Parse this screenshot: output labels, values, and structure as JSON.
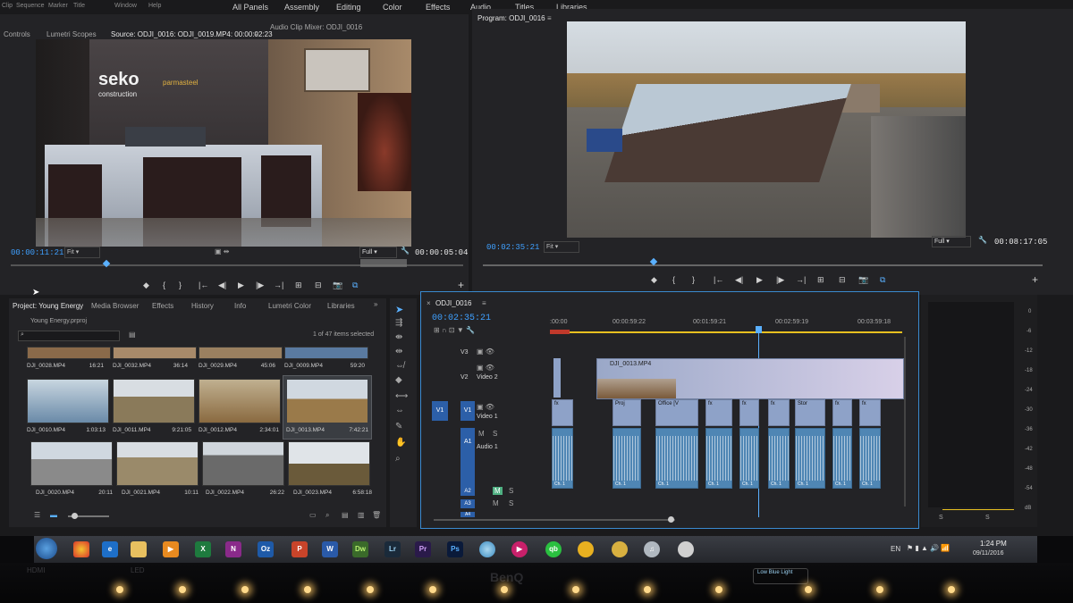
{
  "menu": {
    "items": [
      "Clip",
      "Sequence",
      "Marker",
      "Title",
      "Window",
      "Help"
    ]
  },
  "workspaces": [
    "All Panels",
    "Assembly",
    "Editing",
    "Color",
    "Effects",
    "Audio",
    "Titles",
    "Libraries"
  ],
  "source_panel": {
    "tabs": [
      "Controls",
      "Lumetri Scopes",
      "Source: ODJI_0016: ODJI_0019.MP4: 00:00:02:23",
      "Audio Clip Mixer: ODJI_0016"
    ],
    "menu_icon": "≡",
    "timecode_left": "00:00:11:21",
    "fit": "Fit",
    "zoom": "Full",
    "timecode_right": "00:00:05:04",
    "frame_logo_main": "seko",
    "frame_logo_sub": "construction",
    "frame_logo_partner": "parmasteel"
  },
  "program_panel": {
    "title": "Program: ODJI_0016",
    "menu_icon": "≡",
    "timecode_left": "00:02:35:21",
    "fit": "Fit",
    "zoom": "Full",
    "timecode_right": "00:08:17:05"
  },
  "transport_glyphs": [
    "◆",
    "{",
    "}",
    "|←",
    "◀|",
    "▶",
    "|▶",
    "→|",
    "⊞",
    "⊟",
    "📷",
    "⧉",
    "+"
  ],
  "project_panel": {
    "tabs": [
      "Project: Young Energy",
      "Media Browser",
      "Effects",
      "History",
      "Info",
      "Lumetri Color",
      "Libraries",
      "»"
    ],
    "project_file": "Young Energy.prproj",
    "items_selected": "1 of 47 items selected",
    "top_row": [
      {
        "name": "DJI_0028.MP4",
        "dur": "16:21"
      },
      {
        "name": "DJI_0032.MP4",
        "dur": "36:14"
      },
      {
        "name": "DJI_0029.MP4",
        "dur": "45:06"
      },
      {
        "name": "DJI_0009.MP4",
        "dur": "59:20"
      }
    ],
    "rows": [
      [
        {
          "name": "DJI_0010.MP4",
          "dur": "1:03:13"
        },
        {
          "name": "DJI_0011.MP4",
          "dur": "9:21:05"
        },
        {
          "name": "DJI_0012.MP4",
          "dur": "2:34:01"
        },
        {
          "name": "DJI_0013.MP4",
          "dur": "7:42:21"
        }
      ],
      [
        {
          "name": "DJI_0020.MP4",
          "dur": "20:11"
        },
        {
          "name": "DJI_0021.MP4",
          "dur": "10:11"
        },
        {
          "name": "DJI_0022.MP4",
          "dur": "26:22"
        },
        {
          "name": "DJI_0023.MP4",
          "dur": "6:58:18"
        }
      ]
    ]
  },
  "timeline": {
    "sequence_tab": "ODJI_0016",
    "close_glyph": "×",
    "menu_icon": "≡",
    "timecode": "00:02:35:21",
    "ruler": [
      ":00:00",
      "00:00:59:22",
      "00:01:59:21",
      "00:02:59:19",
      "00:03:59:18"
    ],
    "tracks_video": [
      {
        "id": "V3",
        "name": ""
      },
      {
        "id": "V2",
        "name": "Video 2"
      },
      {
        "id": "V1",
        "name": "Video 1",
        "src": "V1"
      }
    ],
    "tracks_audio": [
      {
        "id": "A1",
        "name": "Audio 1",
        "src": "A1"
      },
      {
        "id": "A2",
        "name": ""
      },
      {
        "id": "A3",
        "name": ""
      },
      {
        "id": "A4",
        "name": ""
      }
    ],
    "toggle_M": "M",
    "toggle_S": "S",
    "v2_clip": "DJI_0013.MP4",
    "v1_clips": [
      "fx",
      "Proj",
      "Office [V",
      "fx",
      "fx",
      "fx",
      "Stor",
      "fx",
      "fx"
    ],
    "audio_clip_label": "Ch. 1"
  },
  "meters": {
    "scale": [
      "0",
      "-6",
      "-12",
      "-18",
      "-24",
      "-30",
      "-36",
      "-42",
      "-48",
      "-54",
      "dB"
    ],
    "solo": [
      "S",
      "S"
    ]
  },
  "taskbar": {
    "lang": "EN",
    "time": "1:24 PM",
    "date": "09/11/2016",
    "apps": [
      "X",
      "N",
      "Oz",
      "P",
      "W",
      "Dw",
      "Lr",
      "Pr",
      "Ps"
    ]
  },
  "bezel": {
    "brand": "BenQ",
    "hdmi": "HDMI",
    "led": "LED",
    "lowblue": "Low Blue Light"
  }
}
